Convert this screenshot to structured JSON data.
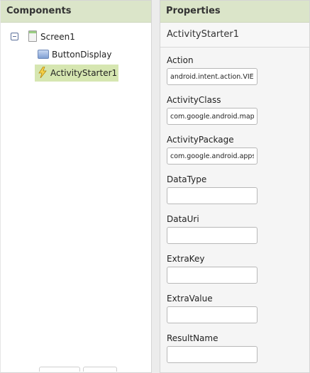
{
  "components": {
    "header": "Components",
    "tree": {
      "screen": "Screen1",
      "children": [
        "ButtonDisplay",
        "ActivityStarter1"
      ],
      "selected": "ActivityStarter1"
    }
  },
  "properties": {
    "header": "Properties",
    "component_name": "ActivityStarter1",
    "fields": [
      {
        "label": "Action",
        "value": "android.intent.action.VIEW"
      },
      {
        "label": "ActivityClass",
        "value": "com.google.android.maps.MapsActivity"
      },
      {
        "label": "ActivityPackage",
        "value": "com.google.android.apps.maps"
      },
      {
        "label": "DataType",
        "value": ""
      },
      {
        "label": "DataUri",
        "value": ""
      },
      {
        "label": "ExtraKey",
        "value": ""
      },
      {
        "label": "ExtraValue",
        "value": ""
      },
      {
        "label": "ResultName",
        "value": ""
      }
    ]
  },
  "colors": {
    "header_bg": "#dbe5c9",
    "selected_bg": "#d6e6b1"
  },
  "icons": {
    "collapse": "collapse-icon",
    "screen": "screen-icon",
    "button": "button-component-icon",
    "activity_starter": "lightning-bolt-icon"
  }
}
